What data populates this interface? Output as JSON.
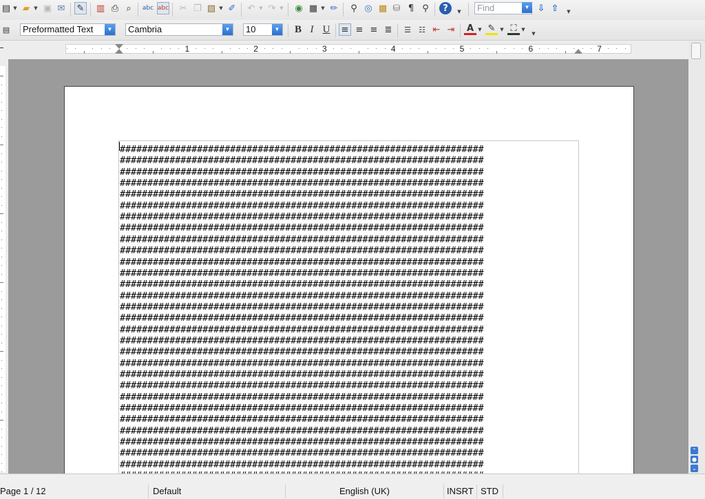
{
  "toolbar_standard": {
    "find_placeholder": "Find"
  },
  "toolbar_formatting": {
    "paragraph_style": "Preformatted Text",
    "font_name": "Cambria",
    "font_size": "10"
  },
  "ruler": {
    "labels": [
      "1",
      "2",
      "3",
      "4",
      "5",
      "6",
      "7"
    ]
  },
  "document": {
    "line_text": "##################################################################",
    "line_count": 30
  },
  "statusbar": {
    "page_info": "Page 1 / 12",
    "page_style": "Default",
    "language": "English (UK)",
    "insert_mode": "INSRT",
    "selection_mode": "STD"
  }
}
